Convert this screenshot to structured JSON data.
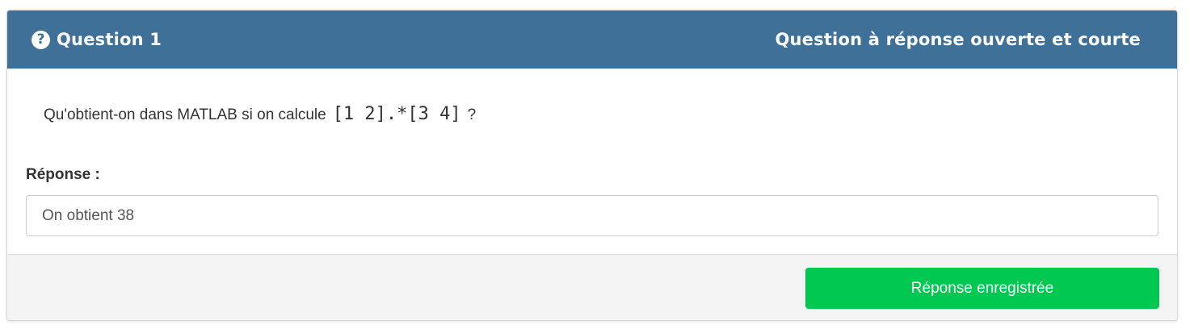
{
  "header": {
    "icon": "question-circle-icon",
    "title": "Question 1",
    "question_type": "Question à réponse ouverte et courte",
    "background_color": "#3e7098"
  },
  "question": {
    "text_before": "Qu'obtient-on dans MATLAB si on calcule",
    "code": "[1 2].*[3 4]",
    "text_after": "?"
  },
  "answer": {
    "label": "Réponse :",
    "value": "On obtient 38"
  },
  "footer": {
    "button_label": "Réponse enregistrée",
    "button_color": "#00c851"
  }
}
